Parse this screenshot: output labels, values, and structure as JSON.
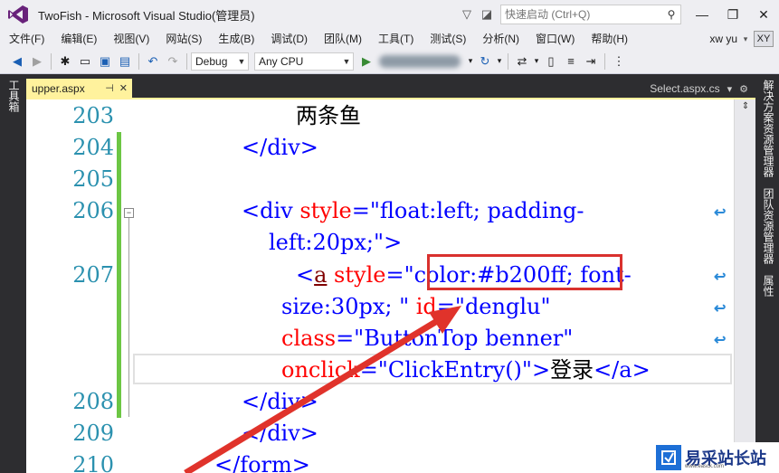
{
  "window": {
    "title": "TwoFish - Microsoft Visual Studio(管理员)",
    "quick_launch_placeholder": "快速启动 (Ctrl+Q)",
    "user_name": "xw yu",
    "user_initials": "XY"
  },
  "menu": {
    "items": [
      "文件(F)",
      "编辑(E)",
      "视图(V)",
      "网站(S)",
      "生成(B)",
      "调试(D)",
      "团队(M)",
      "工具(T)",
      "测试(S)",
      "分析(N)",
      "窗口(W)",
      "帮助(H)"
    ]
  },
  "toolbar": {
    "configuration": "Debug",
    "platform": "Any CPU"
  },
  "side_panels": {
    "left": "工具箱",
    "right": [
      "解决方案资源管理器",
      "团队资源管理器",
      "属性"
    ]
  },
  "tabs": {
    "active": "upper.aspx",
    "other": "Select.aspx.cs"
  },
  "editor": {
    "line_numbers": [
      "203",
      "204",
      "205",
      "206",
      "207",
      "208",
      "209",
      "210"
    ],
    "lines": {
      "l203_text": "两条鱼",
      "l204_close": "</div>",
      "l206_open": "<div ",
      "l206_attr": "style",
      "l206_eq": "=",
      "l206_val1": "\"float:left; padding-",
      "l206b_val": "left:20px;\"",
      "l206b_end": ">",
      "l207_open": "<",
      "l207_tag": "a",
      "l207_attr": " style",
      "l207_eq": "=\"",
      "l207_val_hl": "color:#b200ff;",
      "l207_val_rest": " font-",
      "l207b_val": "size:30px; \"",
      "l207b_attr": " id",
      "l207b_eq": "=",
      "l207b_idval": "\"denglu\"",
      "l207c_attr": "class",
      "l207c_eq": "=",
      "l207c_val": "\"ButtonTop benner\"",
      "l207d_attr": "onclick",
      "l207d_eq": "=",
      "l207d_val": "\"ClickEntry()\"",
      "l207d_gt": ">",
      "l207d_text": "登录",
      "l207d_close": "</a>",
      "l208_close": "</div>",
      "l209_close": "</div>",
      "l210_close": "</form>"
    }
  },
  "watermark": {
    "text": "易采站长站",
    "sub": "www.easck.com"
  },
  "colors": {
    "highlight_box": "#d9312e",
    "arrow": "#e0332b",
    "tab_active": "#fff29d"
  }
}
